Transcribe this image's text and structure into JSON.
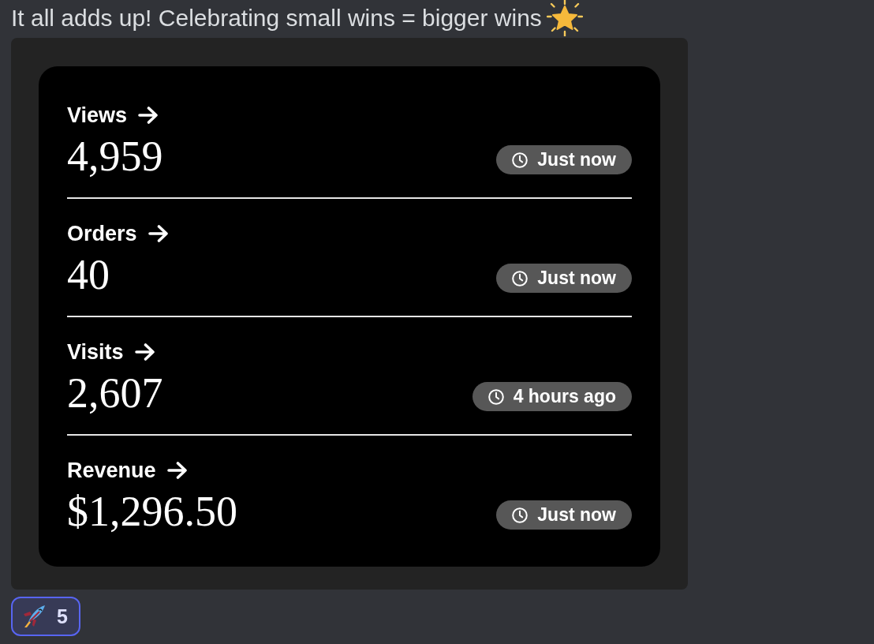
{
  "message": {
    "text": "It all adds up! Celebrating small wins = bigger wins"
  },
  "stats_card": {
    "metrics": [
      {
        "label": "Views",
        "value": "4,959",
        "updated": "Just now"
      },
      {
        "label": "Orders",
        "value": "40",
        "updated": "Just now"
      },
      {
        "label": "Visits",
        "value": "2,607",
        "updated": "4 hours ago"
      },
      {
        "label": "Revenue",
        "value": "$1,296.50",
        "updated": "Just now"
      }
    ]
  },
  "reactions": [
    {
      "count": "5",
      "selected": true
    }
  ]
}
